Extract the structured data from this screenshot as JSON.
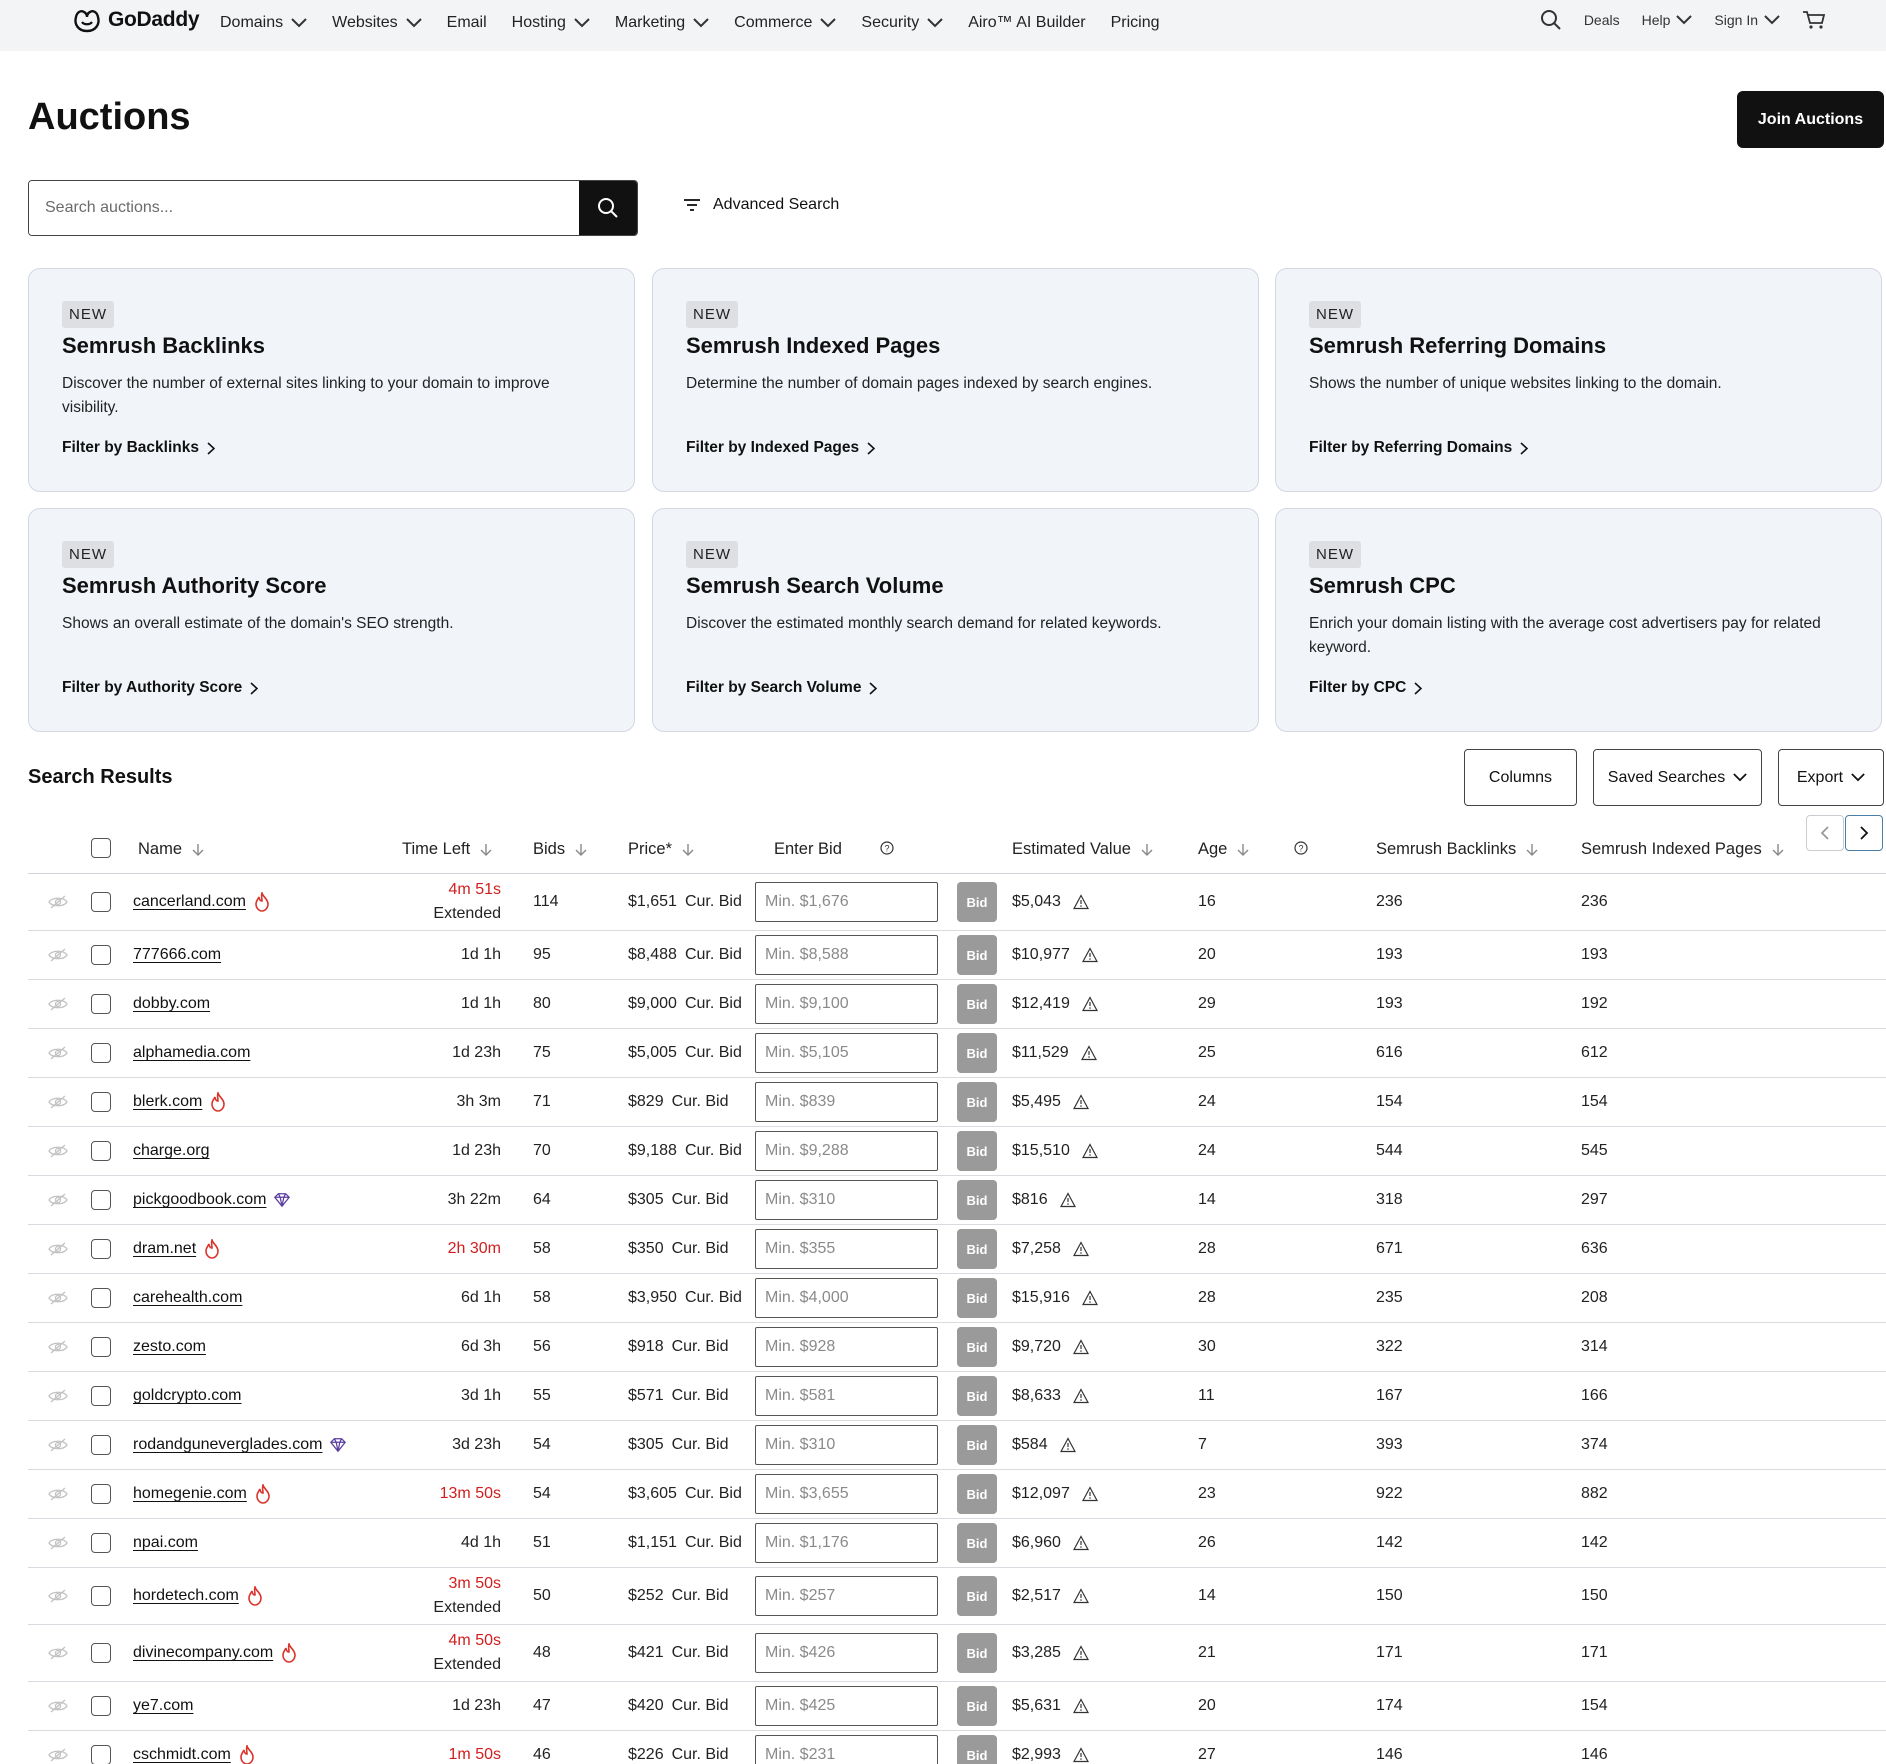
{
  "nav": {
    "logo": "GoDaddy",
    "items": [
      {
        "label": "Domains",
        "has_menu": true
      },
      {
        "label": "Websites",
        "has_menu": true
      },
      {
        "label": "Email",
        "has_menu": false
      },
      {
        "label": "Hosting",
        "has_menu": true
      },
      {
        "label": "Marketing",
        "has_menu": true
      },
      {
        "label": "Commerce",
        "has_menu": true
      },
      {
        "label": "Security",
        "has_menu": true
      },
      {
        "label": "Airo™ AI Builder",
        "has_menu": false
      },
      {
        "label": "Pricing",
        "has_menu": false
      }
    ],
    "deals": "Deals",
    "help": "Help",
    "sign_in": "Sign In"
  },
  "page": {
    "title": "Auctions",
    "join_button": "Join Auctions",
    "search_placeholder": "Search auctions...",
    "advanced_search": "Advanced Search"
  },
  "cards": [
    {
      "badge": "NEW",
      "title": "Semrush Backlinks",
      "desc": "Discover the number of external sites linking to your domain to improve visibility.",
      "link": "Filter by Backlinks"
    },
    {
      "badge": "NEW",
      "title": "Semrush Indexed Pages",
      "desc": "Determine the number of domain pages indexed by search engines.",
      "link": "Filter by Indexed Pages"
    },
    {
      "badge": "NEW",
      "title": "Semrush Referring Domains",
      "desc": "Shows the number of unique websites linking to the domain.",
      "link": "Filter by Referring Domains"
    },
    {
      "badge": "NEW",
      "title": "Semrush Authority Score",
      "desc": "Shows an overall estimate of the domain's SEO strength.",
      "link": "Filter by Authority Score"
    },
    {
      "badge": "NEW",
      "title": "Semrush Search Volume",
      "desc": "Discover the estimated monthly search demand for related keywords.",
      "link": "Filter by Search Volume"
    },
    {
      "badge": "NEW",
      "title": "Semrush CPC",
      "desc": "Enrich your domain listing with the average cost advertisers pay for related keyword.",
      "link": "Filter by CPC"
    }
  ],
  "results": {
    "title": "Search Results",
    "columns_button": "Columns",
    "saved_searches_button": "Saved Searches",
    "export_button": "Export",
    "headers": {
      "name": "Name",
      "time_left": "Time Left",
      "bids": "Bids",
      "price": "Price*",
      "enter_bid": "Enter Bid",
      "estimated_value": "Estimated Value",
      "age": "Age",
      "backlinks": "Semrush Backlinks",
      "indexed_pages": "Semrush Indexed Pages"
    },
    "price_suffix": "Cur. Bid",
    "bid_label": "Bid",
    "colors": {
      "urgent": "#d21e1e",
      "fire": "#d9342b",
      "gem": "#5b3fa0",
      "bid_button": "#9a9a9a"
    },
    "rows": [
      {
        "name": "cancerland.com",
        "icon": "fire-icon",
        "time": "4m 51s",
        "time2": "Extended",
        "urgent": true,
        "bids": "114",
        "price": "$1,651",
        "min": "Min. $1,676",
        "est": "$5,043",
        "age": "16",
        "backlinks": "236",
        "indexed": "236"
      },
      {
        "name": "777666.com",
        "icon": "",
        "time": "1d 1h",
        "time2": "",
        "urgent": false,
        "bids": "95",
        "price": "$8,488",
        "min": "Min. $8,588",
        "est": "$10,977",
        "age": "20",
        "backlinks": "193",
        "indexed": "193"
      },
      {
        "name": "dobby.com",
        "icon": "",
        "time": "1d 1h",
        "time2": "",
        "urgent": false,
        "bids": "80",
        "price": "$9,000",
        "min": "Min. $9,100",
        "est": "$12,419",
        "age": "29",
        "backlinks": "193",
        "indexed": "192"
      },
      {
        "name": "alphamedia.com",
        "icon": "",
        "time": "1d 23h",
        "time2": "",
        "urgent": false,
        "bids": "75",
        "price": "$5,005",
        "min": "Min. $5,105",
        "est": "$11,529",
        "age": "25",
        "backlinks": "616",
        "indexed": "612"
      },
      {
        "name": "blerk.com",
        "icon": "fire-icon",
        "time": "3h 3m",
        "time2": "",
        "urgent": false,
        "bids": "71",
        "price": "$829",
        "min": "Min. $839",
        "est": "$5,495",
        "age": "24",
        "backlinks": "154",
        "indexed": "154"
      },
      {
        "name": "charge.org",
        "icon": "",
        "time": "1d 23h",
        "time2": "",
        "urgent": false,
        "bids": "70",
        "price": "$9,188",
        "min": "Min. $9,288",
        "est": "$15,510",
        "age": "24",
        "backlinks": "544",
        "indexed": "545"
      },
      {
        "name": "pickgoodbook.com",
        "icon": "gem-icon",
        "time": "3h 22m",
        "time2": "",
        "urgent": false,
        "bids": "64",
        "price": "$305",
        "min": "Min. $310",
        "est": "$816",
        "age": "14",
        "backlinks": "318",
        "indexed": "297"
      },
      {
        "name": "dram.net",
        "icon": "fire-icon",
        "time": "2h 30m",
        "time2": "",
        "urgent": true,
        "bids": "58",
        "price": "$350",
        "min": "Min. $355",
        "est": "$7,258",
        "age": "28",
        "backlinks": "671",
        "indexed": "636"
      },
      {
        "name": "carehealth.com",
        "icon": "",
        "time": "6d 1h",
        "time2": "",
        "urgent": false,
        "bids": "58",
        "price": "$3,950",
        "min": "Min. $4,000",
        "est": "$15,916",
        "age": "28",
        "backlinks": "235",
        "indexed": "208"
      },
      {
        "name": "zesto.com",
        "icon": "",
        "time": "6d 3h",
        "time2": "",
        "urgent": false,
        "bids": "56",
        "price": "$918",
        "min": "Min. $928",
        "est": "$9,720",
        "age": "30",
        "backlinks": "322",
        "indexed": "314"
      },
      {
        "name": "goldcrypto.com",
        "icon": "",
        "time": "3d 1h",
        "time2": "",
        "urgent": false,
        "bids": "55",
        "price": "$571",
        "min": "Min. $581",
        "est": "$8,633",
        "age": "11",
        "backlinks": "167",
        "indexed": "166"
      },
      {
        "name": "rodandguneverglades.com",
        "icon": "gem-icon",
        "time": "3d 23h",
        "time2": "",
        "urgent": false,
        "bids": "54",
        "price": "$305",
        "min": "Min. $310",
        "est": "$584",
        "age": "7",
        "backlinks": "393",
        "indexed": "374"
      },
      {
        "name": "homegenie.com",
        "icon": "fire-icon",
        "time": "13m 50s",
        "time2": "",
        "urgent": true,
        "bids": "54",
        "price": "$3,605",
        "min": "Min. $3,655",
        "est": "$12,097",
        "age": "23",
        "backlinks": "922",
        "indexed": "882"
      },
      {
        "name": "npai.com",
        "icon": "",
        "time": "4d 1h",
        "time2": "",
        "urgent": false,
        "bids": "51",
        "price": "$1,151",
        "min": "Min. $1,176",
        "est": "$6,960",
        "age": "26",
        "backlinks": "142",
        "indexed": "142"
      },
      {
        "name": "hordetech.com",
        "icon": "fire-icon",
        "time": "3m 50s",
        "time2": "Extended",
        "urgent": true,
        "bids": "50",
        "price": "$252",
        "min": "Min. $257",
        "est": "$2,517",
        "age": "14",
        "backlinks": "150",
        "indexed": "150"
      },
      {
        "name": "divinecompany.com",
        "icon": "fire-icon",
        "time": "4m 50s",
        "time2": "Extended",
        "urgent": true,
        "bids": "48",
        "price": "$421",
        "min": "Min. $426",
        "est": "$3,285",
        "age": "21",
        "backlinks": "171",
        "indexed": "171"
      },
      {
        "name": "ye7.com",
        "icon": "",
        "time": "1d 23h",
        "time2": "",
        "urgent": false,
        "bids": "47",
        "price": "$420",
        "min": "Min. $425",
        "est": "$5,631",
        "age": "20",
        "backlinks": "174",
        "indexed": "154"
      },
      {
        "name": "cschmidt.com",
        "icon": "fire-icon",
        "time": "1m 50s",
        "time2": "",
        "urgent": true,
        "bids": "46",
        "price": "$226",
        "min": "Min. $231",
        "est": "$2,993",
        "age": "27",
        "backlinks": "146",
        "indexed": "146"
      }
    ]
  }
}
